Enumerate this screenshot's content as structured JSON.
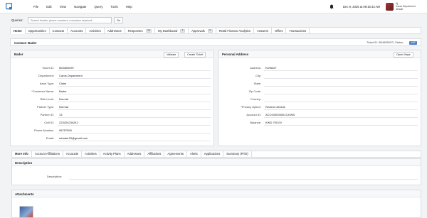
{
  "app": {
    "menu": [
      "File",
      "Edit",
      "View",
      "Navigate",
      "Query",
      "Tools",
      "Help"
    ],
    "datetime": "Dec 9, 2025 at 09:16:43 AM",
    "user_name": "Aj",
    "user_dept": "Cards Department",
    "user_sub": "default"
  },
  "query": {
    "label": "Queries:",
    "placeholder": "Search tickets, phone numbers, resolution keyword...",
    "go_label": "Go"
  },
  "nav_tabs": [
    {
      "label": "Home",
      "badge": ""
    },
    {
      "label": "Opportunities",
      "badge": ""
    },
    {
      "label": "Contacts",
      "badge": ""
    },
    {
      "label": "Accounts",
      "badge": ""
    },
    {
      "label": "Activities",
      "badge": ""
    },
    {
      "label": "Addresses",
      "badge": ""
    },
    {
      "label": "Responses",
      "badge": "16"
    },
    {
      "label": "My Dashboard",
      "badge": "1"
    },
    {
      "label": "Approvals",
      "badge": "0"
    },
    {
      "label": "Retail Finance Analytics",
      "badge": ""
    },
    {
      "label": "Answers",
      "badge": ""
    },
    {
      "label": "Offers",
      "badge": ""
    },
    {
      "label": "Transactions",
      "badge": ""
    }
  ],
  "contact": {
    "title": "Contact: Bader",
    "ticket_ref": "Ticket ID: I504805097",
    "status_label": "Status:",
    "status_value": "WIP"
  },
  "left_panel": {
    "title": "Bader",
    "validate_label": "Validate",
    "create_ticket_label": "Create Ticket",
    "fields": [
      {
        "label": "Ticket ID:",
        "value": "I504805097"
      },
      {
        "label": "Department:",
        "value": "Cards Department"
      },
      {
        "label": "Issue Type:",
        "value": "Claim"
      },
      {
        "label": "*Customer Name:",
        "value": "Bader"
      },
      {
        "label": "Risk Level:",
        "value": "Normal"
      },
      {
        "label": "Partner Type:",
        "value": "Normal"
      },
      {
        "label": "Partner ID:",
        "value": "13"
      },
      {
        "label": "Civil ID:",
        "value": "223424234242"
      },
      {
        "label": "Phone Number:",
        "value": "96757590"
      },
      {
        "label": "Email:",
        "value": "mbader23@gmail.com"
      }
    ]
  },
  "right_panel": {
    "title": "Personal Address",
    "open_maps_label": "Open Maps",
    "fields": [
      {
        "label": "Address:",
        "value": "KUWAIT"
      },
      {
        "label": "City:",
        "value": ""
      },
      {
        "label": "State:",
        "value": ""
      },
      {
        "label": "Zip Code:",
        "value": ""
      },
      {
        "label": "Country:",
        "value": ""
      },
      {
        "label": "*Privacy Option:",
        "value": "Recieve All Ads"
      },
      {
        "label": "Account ID:",
        "value": "ACC0000000013-KWD"
      },
      {
        "label": "Balance:",
        "value": "KWD 700.00"
      }
    ]
  },
  "lower_tabs": [
    "More Info",
    "Account Affiliations",
    "Accounts",
    "Activities",
    "Activity Plans",
    "Addresses",
    "Affiliations",
    "Agreements",
    "Alerts",
    "Applications",
    "Summary (RTD)"
  ],
  "description_section": {
    "title": "Description",
    "field_label": "Description:"
  },
  "attachments_section": {
    "title": "Attachments"
  },
  "colors": {
    "accent": "#4e7fc4",
    "logo": "#2f7dbd"
  }
}
